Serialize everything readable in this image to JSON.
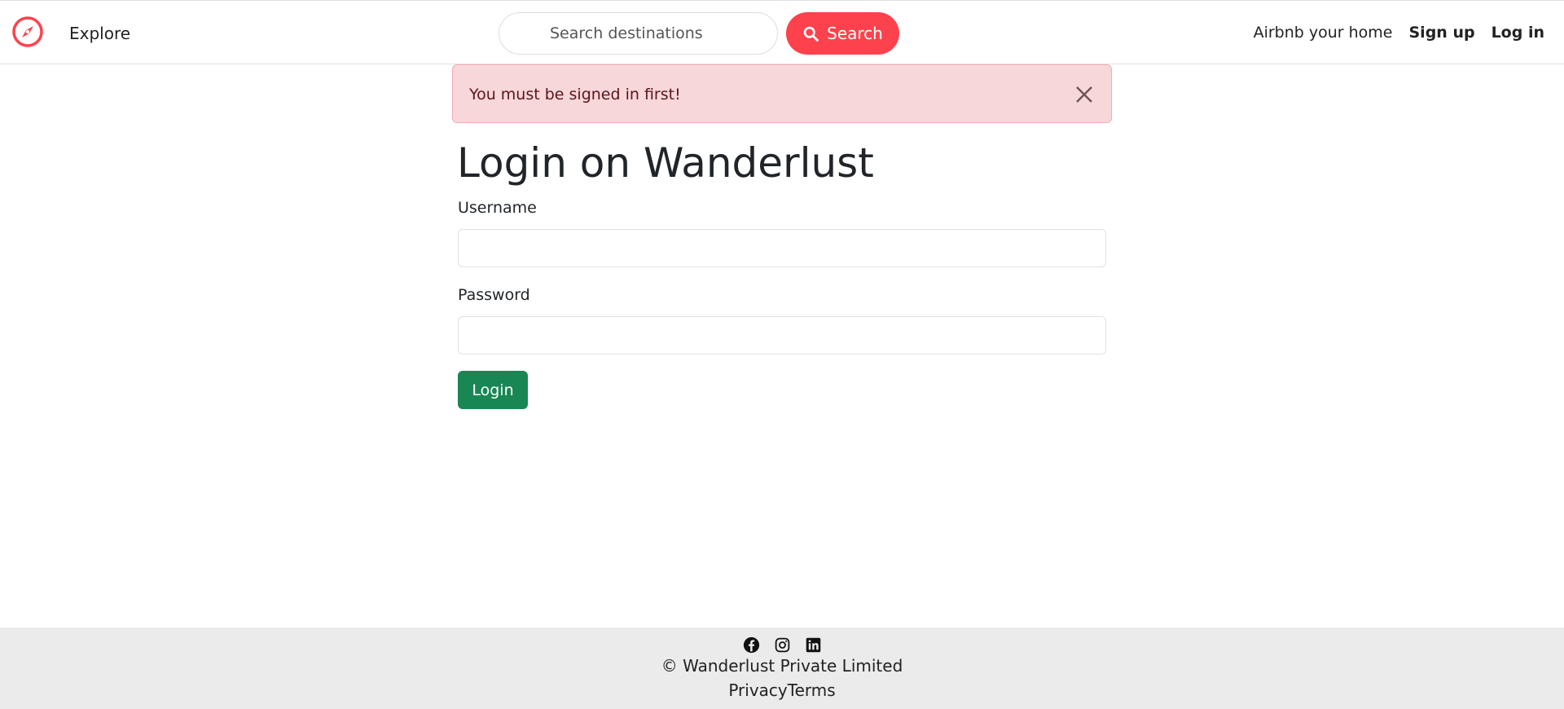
{
  "navbar": {
    "logo_icon": "compass-icon",
    "explore_label": "Explore",
    "search_placeholder": "Search destinations",
    "search_button_label": "Search",
    "search_icon": "search-icon",
    "host_link": "Airbnb your home",
    "signup_link": "Sign up",
    "login_link": "Log in"
  },
  "alert": {
    "message": "You must be signed in first!",
    "close_icon": "close-icon"
  },
  "main": {
    "title": "Login on Wanderlust",
    "username_label": "Username",
    "username_value": "",
    "password_label": "Password",
    "password_value": "",
    "submit_label": "Login"
  },
  "footer": {
    "social_icons": [
      "facebook-icon",
      "instagram-icon",
      "linkedin-icon"
    ],
    "copyright": "© Wanderlust Private Limited",
    "privacy_link": "Privacy",
    "terms_link": "Terms"
  },
  "colors": {
    "brand": "#fe424d",
    "success": "#198754",
    "alert_bg": "#f8d7da",
    "alert_text": "#58151c",
    "footer_bg": "#ebebeb"
  }
}
